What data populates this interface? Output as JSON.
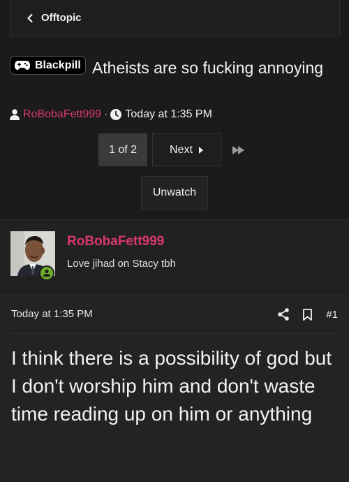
{
  "breadcrumb": {
    "label": "Offtopic",
    "icon": "chevron-left-icon"
  },
  "thread": {
    "prefix": "Blackpill",
    "title": "Atheists are so fucking annoying",
    "author": "RoBobaFett999",
    "separator": "·",
    "time": "Today at 1:35 PM"
  },
  "pagination": {
    "current": "1 of 2",
    "next": "Next"
  },
  "watch_label": "Unwatch",
  "post": {
    "username": "RoBobaFett999",
    "user_title": "Love jihad on Stacy tbh",
    "date": "Today at 1:35 PM",
    "number": "#1",
    "body": "I think there is a possibility of god but I don't worship him and don't waste time reading up on him or anything"
  },
  "colors": {
    "accent": "#d9386a",
    "online": "#6fae2c",
    "background": "#1b1b1b"
  }
}
